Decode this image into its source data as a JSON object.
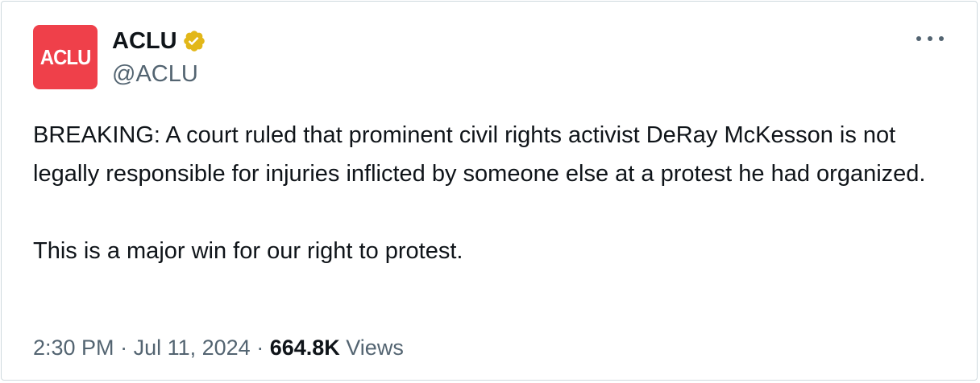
{
  "author": {
    "avatar_text": "ACLU",
    "avatar_color": "#ef404a",
    "display_name": "ACLU",
    "verified_badge": "gold-checkmark-badge",
    "verified_color": "#e2b719",
    "handle": "@ACLU"
  },
  "more_menu_icon": "ellipsis-horizontal-icon",
  "tweet": {
    "paragraphs": [
      "BREAKING: A court ruled that prominent civil rights activist DeRay McKesson is not legally responsible for injuries inflicted by someone else at a protest he had organized.",
      "This is a major win for our right to protest."
    ]
  },
  "meta": {
    "time": "2:30 PM",
    "separator": " · ",
    "date": "Jul 11, 2024",
    "views_count": "664.8K",
    "views_label": "Views"
  }
}
